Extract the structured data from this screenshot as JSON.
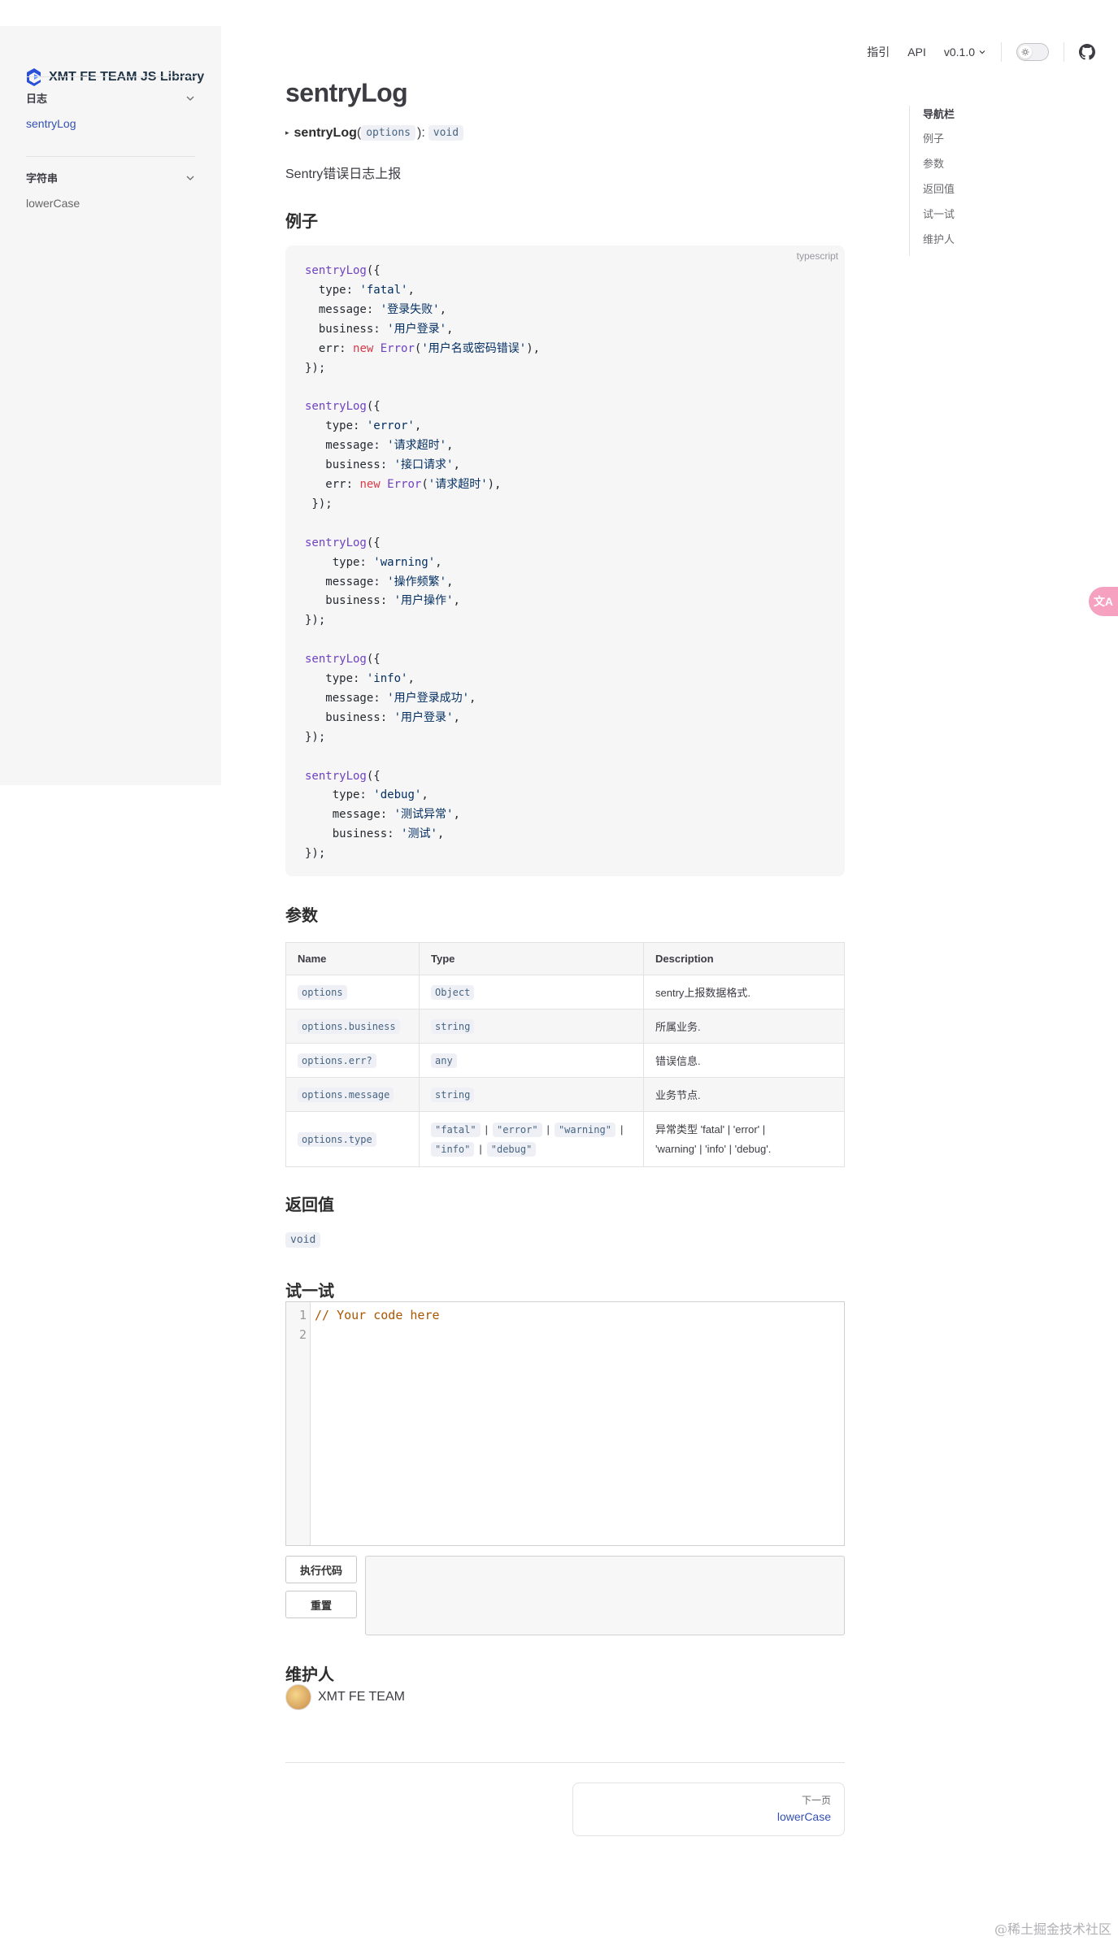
{
  "site": {
    "title": "XMT FE TEAM JS Library"
  },
  "sidebar": {
    "groups": [
      {
        "title": "日志",
        "items": [
          "sentryLog"
        ]
      },
      {
        "title": "字符串",
        "items": [
          "lowerCase"
        ]
      }
    ]
  },
  "nav": {
    "guide": "指引",
    "api": "API",
    "version": "v0.1.0"
  },
  "aside": {
    "title": "导航栏",
    "items": [
      "例子",
      "参数",
      "返回值",
      "试一试",
      "维护人"
    ]
  },
  "page": {
    "title": "sentryLog",
    "signature": {
      "name": "sentryLog",
      "open": "(",
      "param": "options",
      "close": "):",
      "return": "void"
    },
    "description": "Sentry错误日志上报"
  },
  "example": {
    "heading": "例子",
    "lang": "typescript"
  },
  "params": {
    "heading": "参数",
    "columns": [
      "Name",
      "Type",
      "Description"
    ],
    "rows": [
      {
        "name": "options",
        "type": "Object",
        "desc": "sentry上报数据格式."
      },
      {
        "name": "options.business",
        "type": "string",
        "desc": "所属业务."
      },
      {
        "name": "options.err?",
        "type": "any",
        "desc": "错误信息."
      },
      {
        "name": "options.message",
        "type": "string",
        "desc": "业务节点."
      },
      {
        "name": "options.type",
        "types": [
          "\"fatal\"",
          "\"error\"",
          "\"warning\"",
          "\"info\"",
          "\"debug\""
        ],
        "desc_line1": "异常类型 'fatal' | 'error' |",
        "desc_line2": "'warning' | 'info' | 'debug'."
      }
    ]
  },
  "returns": {
    "heading": "返回值",
    "value": "void"
  },
  "playground": {
    "heading": "试一试",
    "line_numbers": [
      "1",
      "2"
    ],
    "code": "// Your code here",
    "run_label": "执行代码",
    "reset_label": "重置"
  },
  "maintainer": {
    "heading": "维护人",
    "name": "XMT FE TEAM"
  },
  "pager": {
    "next_label": "下一页",
    "next_title": "lowerCase"
  },
  "translate_icon": "文A",
  "watermark": "@稀土掘金技术社区",
  "colors": {
    "accent": "#3451b2",
    "code_bg": "#f6f6f7",
    "chip_bg": "#eef0f5"
  }
}
